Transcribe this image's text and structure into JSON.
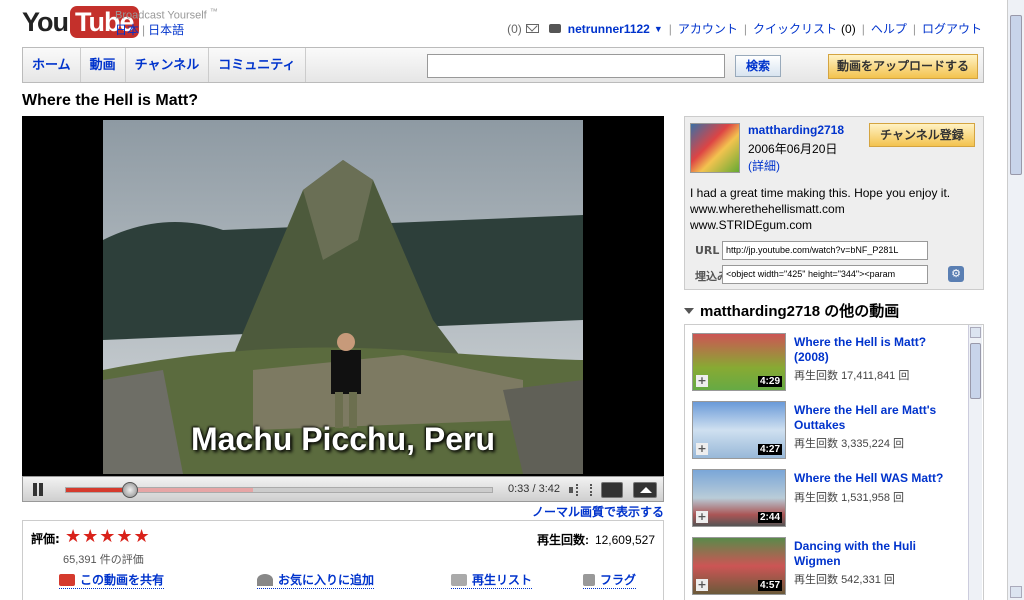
{
  "header": {
    "logo_you": "You",
    "logo_tube": "Tube",
    "tagline": "Broadcast Yourself",
    "tagline_tm": "™",
    "region": "日本",
    "language": "日本語",
    "mail_count": "(0)",
    "username": "netrunner1122",
    "links": {
      "account": "アカウント",
      "quicklist": "クイックリスト",
      "quicklist_count": "(0)",
      "help": "ヘルプ",
      "logout": "ログアウト"
    }
  },
  "nav": {
    "tabs": [
      "ホーム",
      "動画",
      "チャンネル",
      "コミュニティ"
    ],
    "search_value": "",
    "search_button": "検索",
    "upload_button": "動画をアップロードする"
  },
  "video": {
    "title": "Where the Hell is Matt?",
    "caption": "Machu Picchu, Peru",
    "time": "0:33 / 3:42",
    "progress_fraction": 0.15,
    "buffered_fraction": 0.44,
    "quality_link": "ノーマル画質で表示する"
  },
  "ratings": {
    "label": "評価:",
    "stars": "★★★★★",
    "count": "65,391 件の評価",
    "views_label": "再生回数:",
    "views": "12,609,527",
    "actions": {
      "share": "この動画を共有",
      "favorite": "お気に入りに追加",
      "playlist": "再生リスト",
      "flag": "フラグ"
    }
  },
  "uploader": {
    "name": "mattharding2718",
    "date": "2006年06月20日",
    "more": "(詳細)",
    "subscribe": "チャンネル登録",
    "description": [
      "I had a great time making this. Hope you enjoy it.",
      "www.wherethehellismatt.com",
      "www.STRIDEgum.com"
    ],
    "url_label": "URL",
    "url_value": "http://jp.youtube.com/watch?v=bNF_P281L",
    "embed_label": "埋込み",
    "embed_value": "<object width=\"425\" height=\"344\"><param"
  },
  "related": {
    "title": "mattharding2718 の他の動画",
    "items": [
      {
        "title": "Where the Hell is Matt? (2008)",
        "views_label": "再生回数",
        "views": "17,411,841 回",
        "duration": "4:29"
      },
      {
        "title": "Where the Hell are Matt's Outtakes",
        "views_label": "再生回数",
        "views": "3,335,224 回",
        "duration": "4:27"
      },
      {
        "title": "Where the Hell WAS Matt?",
        "views_label": "再生回数",
        "views": "1,531,958 回",
        "duration": "2:44"
      },
      {
        "title": "Dancing with the Huli Wigmen",
        "views_label": "再生回数",
        "views": "542,331 回",
        "duration": "4:57"
      }
    ]
  },
  "colors": {
    "brand_red": "#c4302b",
    "link_blue": "#0033cc",
    "star_red": "#d9221a",
    "progress_red": "#d53a2d",
    "upload_yellow": "#f3c34f"
  }
}
